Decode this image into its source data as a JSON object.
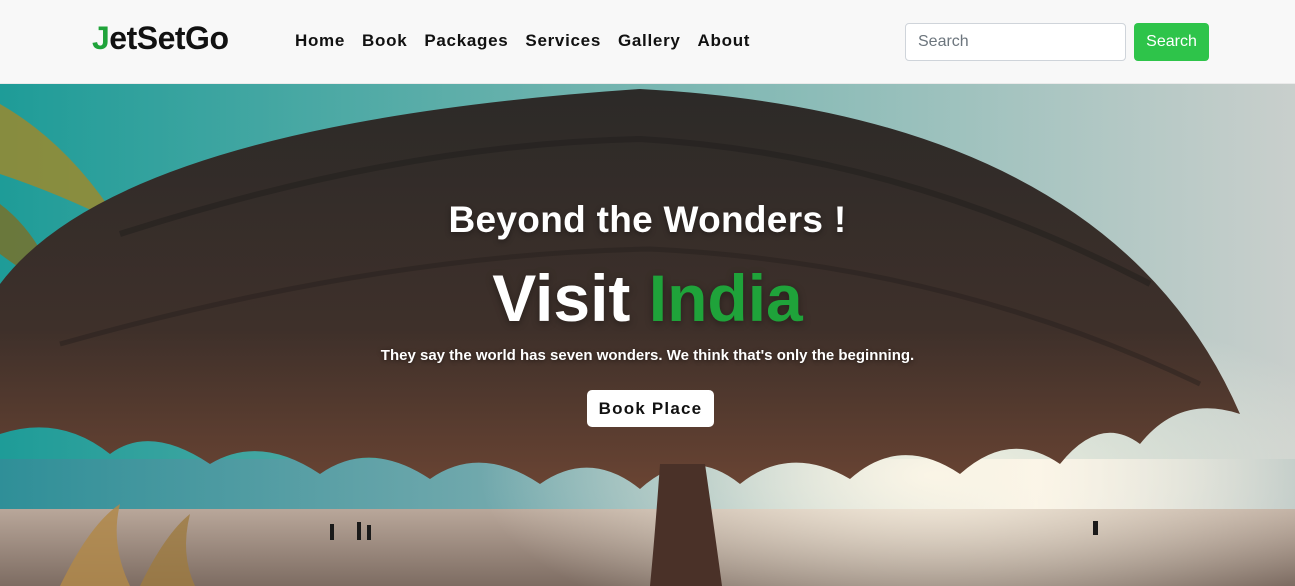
{
  "brand": {
    "first_letter": "J",
    "rest": "etSetGo"
  },
  "nav": {
    "links": [
      "Home",
      "Book",
      "Packages",
      "Services",
      "Gallery",
      "About"
    ]
  },
  "search": {
    "placeholder": "Search",
    "button_label": "Search"
  },
  "hero": {
    "subtitle": "Beyond the Wonders !",
    "title_part1": "Visit",
    "title_part2": "India",
    "tagline": "They say the world has seven wonders. We think that's only the beginning.",
    "button_label": "Book Place"
  },
  "colors": {
    "brand_green": "#1fa33a",
    "search_button": "#2ec44a",
    "navbar_bg": "#f8f8f8"
  },
  "images": {
    "hero_background": "beach-thatched-umbrella-photo"
  }
}
